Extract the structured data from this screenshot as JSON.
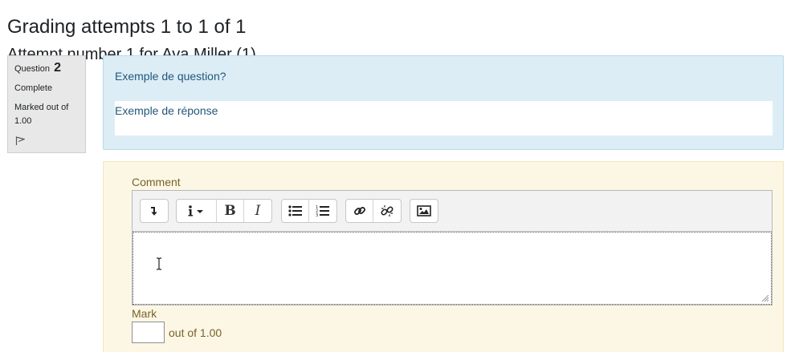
{
  "page": {
    "title": "Grading attempts 1 to 1 of 1",
    "subtitle": "Attempt number 1 for Ava Miller (1)"
  },
  "question_info": {
    "label": "Question",
    "number": "2",
    "state": "Complete",
    "grade": "Marked out of 1.00",
    "flag_icon": "flag-icon"
  },
  "formulation": {
    "question_text": "Exemple de question?",
    "response_text": "Exemple de réponse"
  },
  "comment": {
    "label": "Comment",
    "toolbar": [
      [
        "collapse-icon"
      ],
      [
        "info-icon",
        "bold-icon",
        "italic-icon"
      ],
      [
        "unordered-list-icon",
        "ordered-list-icon"
      ],
      [
        "link-icon",
        "unlink-icon"
      ],
      [
        "image-icon"
      ]
    ],
    "value": ""
  },
  "mark": {
    "label": "Mark",
    "value": "",
    "out_of": "out of 1.00"
  },
  "colors": {
    "formulation_bg": "#dcedf6",
    "comment_bg": "#fcf7e5",
    "info_bg": "#e8e8e8",
    "link_text": "#23577b",
    "label_text": "#7a6229"
  }
}
